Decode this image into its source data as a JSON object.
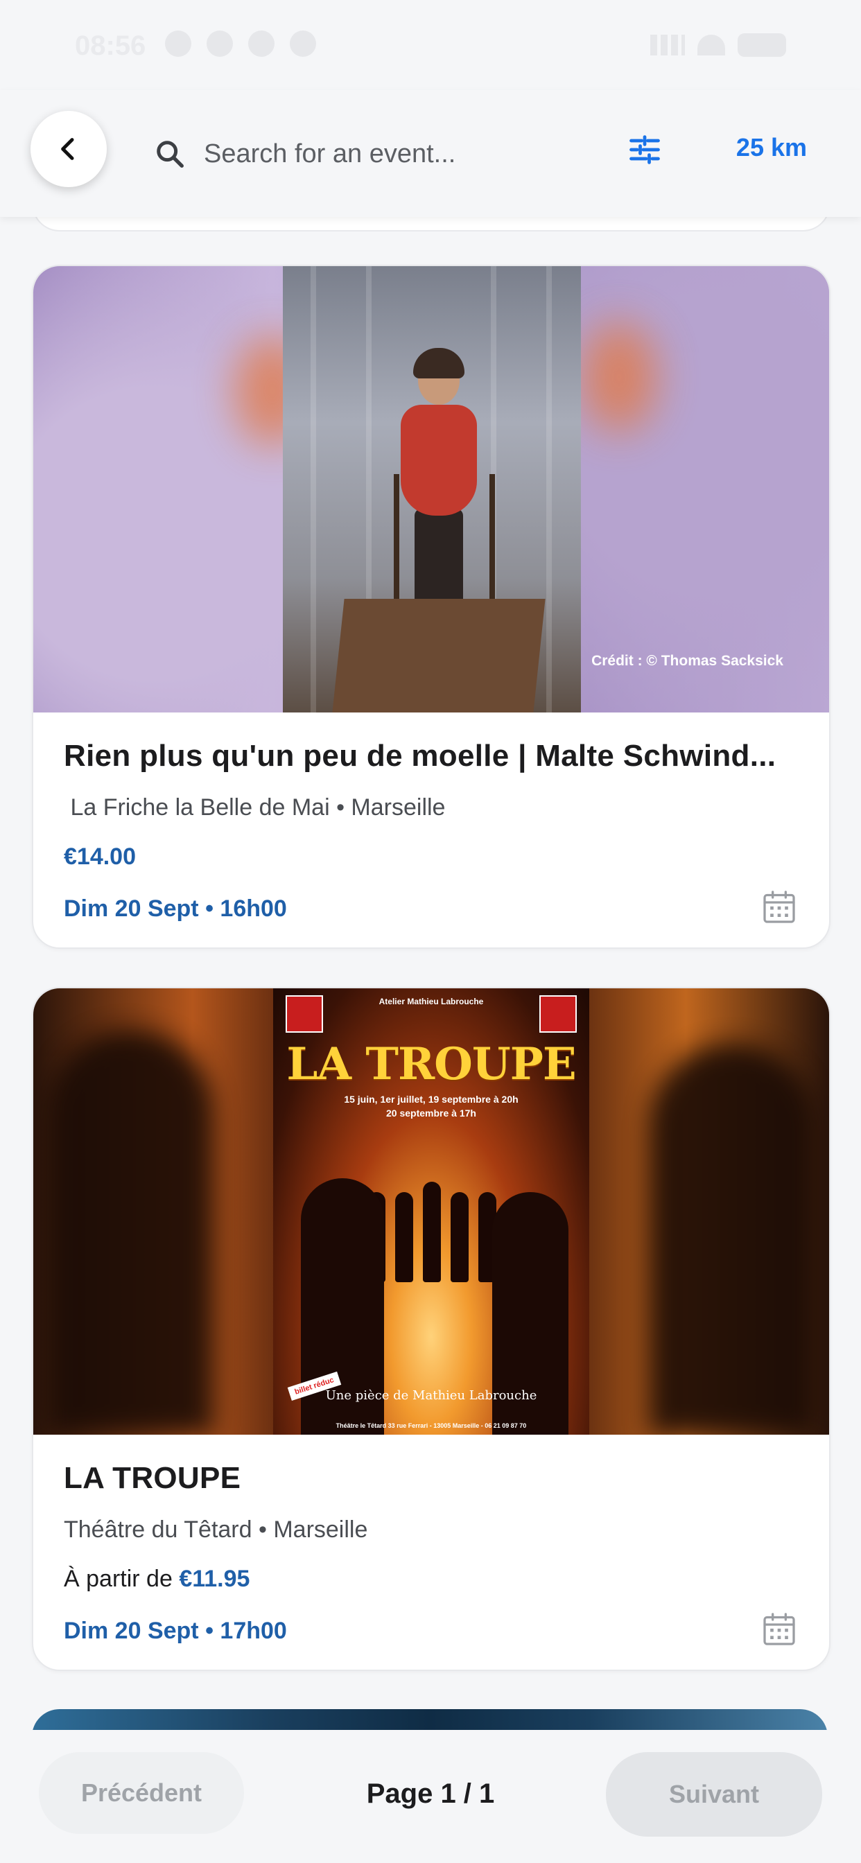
{
  "status_bar": {
    "time": "08:56"
  },
  "header": {
    "search_placeholder": "Search for an event...",
    "radius": "25 km"
  },
  "events": [
    {
      "title": "Rien plus qu'un peu de moelle | Malte Schwind...",
      "venue": "La Friche la Belle de Mai",
      "city": "Marseille",
      "venue_line": " La Friche la Belle de Mai • Marseille",
      "price_prefix": "",
      "price": "€14.00",
      "date": "Dim 20 Sept • 16h00",
      "image_credit": "Crédit : © Thomas Sacksick"
    },
    {
      "title": "LA TROUPE",
      "venue": "Théâtre du Têtard",
      "city": "Marseille",
      "venue_line": "Théâtre du Têtard • Marseille",
      "price_prefix": "À partir de ",
      "price": "€11.95",
      "date": "Dim 20 Sept • 17h00",
      "poster": {
        "header": "Atelier Mathieu Labrouche",
        "title": "LA TROUPE",
        "dates_line1": "15 juin, 1er juillet, 19 septembre à 20h",
        "dates_line2": "20 septembre à 17h",
        "subtitle": "Une pièce de Mathieu Labrouche",
        "footer": "Théâtre le Têtard 33 rue Ferrari - 13005 Marseille - 06 21 09 87 70",
        "sticker": "billet réduc"
      }
    }
  ],
  "pagination": {
    "prev_label": "Précédent",
    "page_info": "Page 1 / 1",
    "next_label": "Suivant"
  },
  "colors": {
    "accent": "#1a73e8",
    "link_blue": "#1f5fa8",
    "background": "#f5f6f8"
  }
}
